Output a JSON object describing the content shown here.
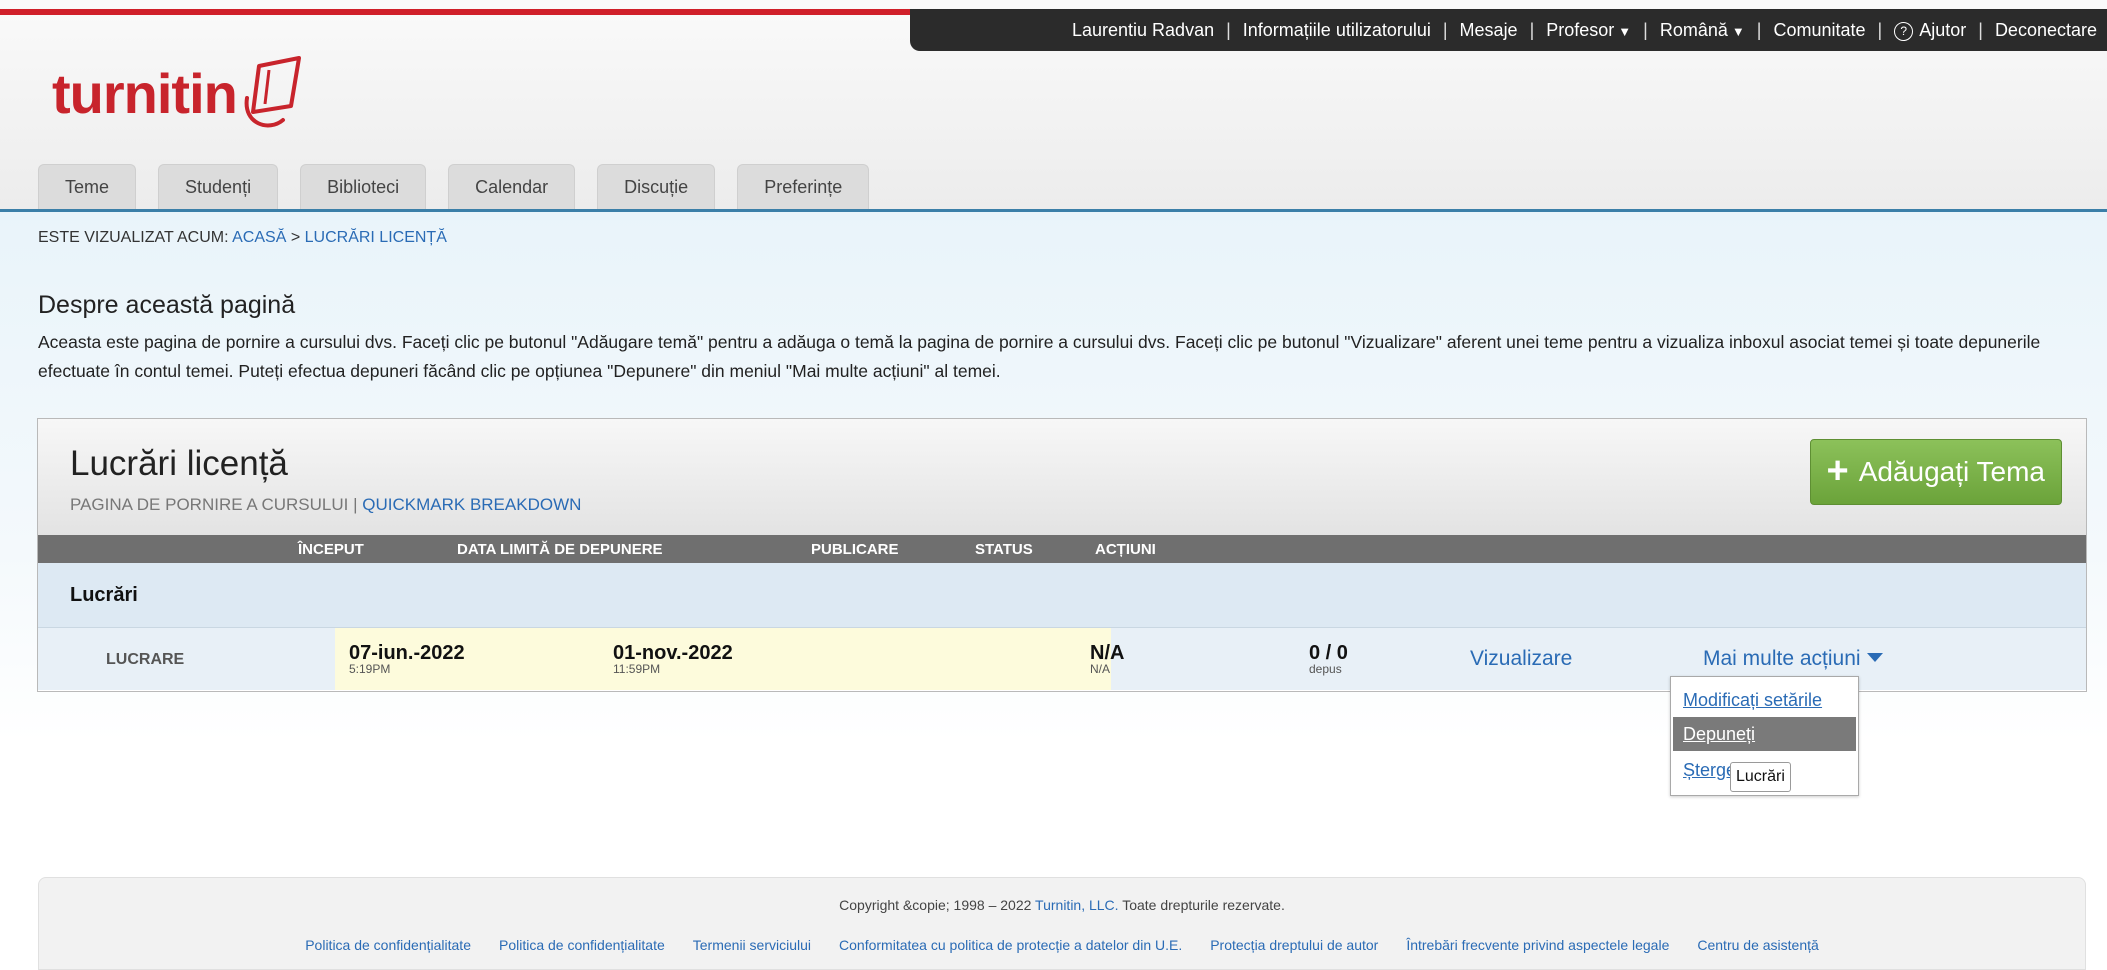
{
  "top_bar": {
    "user_name": "Laurentiu Radvan",
    "user_info": "Informațiile utilizatorului",
    "messages": "Mesaje",
    "role": "Profesor",
    "language": "Română",
    "community": "Comunitate",
    "help": "Ajutor",
    "logout": "Deconectare"
  },
  "logo": {
    "text": "turnitin"
  },
  "tabs": [
    "Teme",
    "Studenți",
    "Biblioteci",
    "Calendar",
    "Discuție",
    "Preferințe"
  ],
  "breadcrumb": {
    "prefix": "ESTE VIZUALIZAT ACUM:",
    "home": "ACASĂ",
    "separator": ">",
    "current": "LUCRĂRI LICENȚĂ"
  },
  "about": {
    "title": "Despre această pagină",
    "text": "Aceasta este pagina de pornire a cursului dvs. Faceți clic pe butonul \"Adăugare temă\" pentru a adăuga o temă la pagina de pornire a cursului dvs. Faceți clic pe butonul \"Vizualizare\" aferent unei teme pentru a vizualiza inboxul asociat temei și toate depunerile efectuate în contul temei. Puteți efectua depuneri făcând clic pe opțiunea \"Depunere\" din meniul \"Mai multe acțiuni\" al temei."
  },
  "class": {
    "title": "Lucrări licență",
    "home_label": "PAGINA DE PORNIRE A CURSULUI",
    "link_sep": "|",
    "quickmark": "QUICKMARK BREAKDOWN",
    "add_button": "Adăugați Tema"
  },
  "columns": {
    "start": "ÎNCEPUT",
    "due": "DATA LIMITĂ DE DEPUNERE",
    "post": "PUBLICARE",
    "status": "STATUS",
    "actions": "ACȚIUNI"
  },
  "section": {
    "label": "Lucrări"
  },
  "assignment": {
    "type": "LUCRARE",
    "start_date": "07-iun.-2022",
    "start_time": "5:19PM",
    "due_date": "01-nov.-2022",
    "due_time": "11:59PM",
    "post": "N/A",
    "post_sub": "N/A",
    "status": "0 / 0",
    "status_sub": "depus",
    "view": "Vizualizare",
    "more_actions": "Mai multe acțiuni"
  },
  "dropdown": {
    "items": [
      "Modificați setările",
      "Depuneți",
      "Ștergeți tema"
    ]
  },
  "tooltip": "Lucrări",
  "footer": {
    "copyright_pre": "Copyright &copie; 1998 – 2022",
    "company": "Turnitin, LLC.",
    "rights": "Toate drepturile rezervate.",
    "links": [
      "Politica de confidențialitate",
      "Politica de confidențialitate",
      "Termenii serviciului",
      "Conformitatea cu politica de protecție a datelor din U.E.",
      "Protecția dreptului de autor",
      "Întrebări frecvente privind aspectele legale",
      "Centru de asistență"
    ]
  },
  "colors": {
    "brand_red": "#c8242c",
    "link_blue": "#2a6bb5",
    "add_green": "#7ab24a",
    "header_dark": "#2b2b2b"
  }
}
